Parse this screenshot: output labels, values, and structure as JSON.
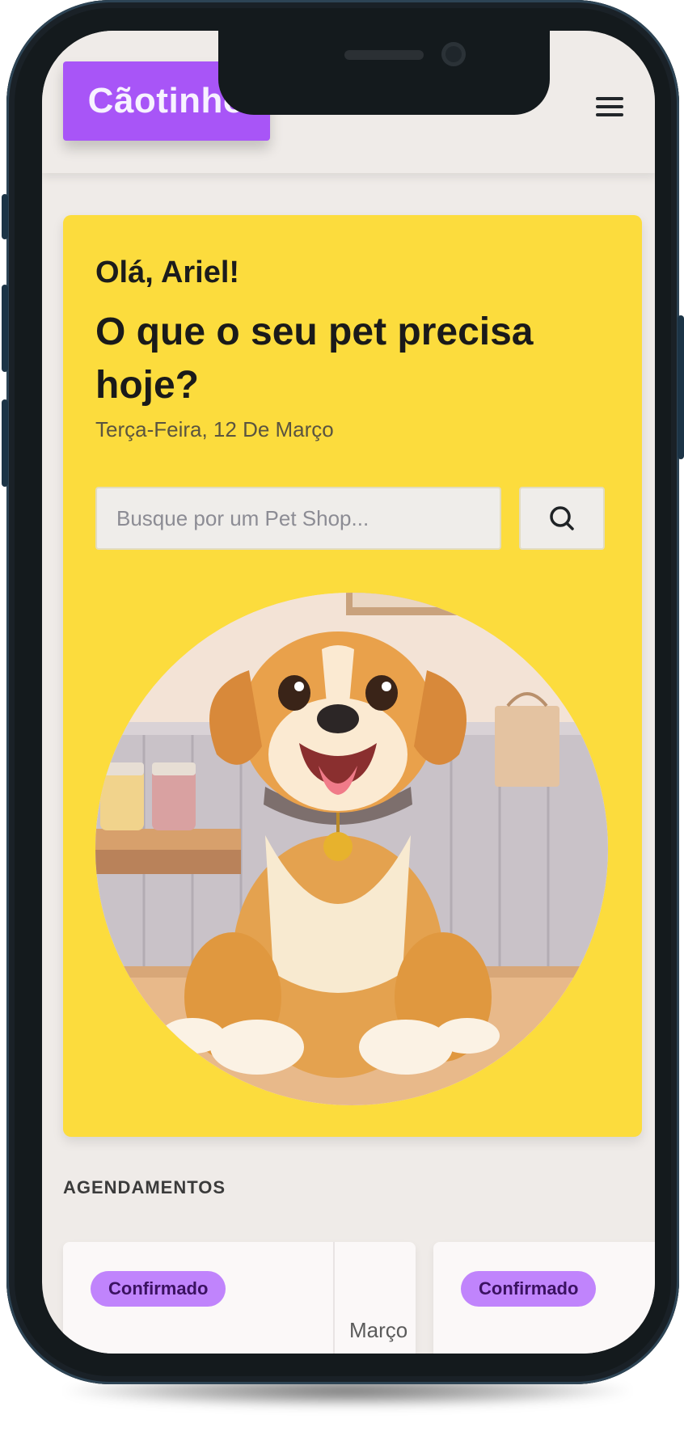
{
  "app": {
    "logo_text": "Cãotinho"
  },
  "header": {
    "menu_icon": "hamburger-menu-icon"
  },
  "hero": {
    "greeting": "Olá, Ariel!",
    "headline": "O que o seu pet precisa hoje?",
    "date": "Terça-Feira, 12 De Março",
    "search": {
      "placeholder": "Busque por um Pet Shop...",
      "value": "",
      "button_icon": "search-icon"
    },
    "illustration": "cartoon-dog-in-pet-shop"
  },
  "appointments": {
    "section_title": "AGENDAMENTOS",
    "items": [
      {
        "status": "Confirmado",
        "month": "Março"
      },
      {
        "status": "Confirmado"
      }
    ]
  },
  "colors": {
    "brand": "#a855f7",
    "hero_bg": "#fcdc3d",
    "badge": "#c084fc",
    "screen_bg": "#efebe8"
  }
}
